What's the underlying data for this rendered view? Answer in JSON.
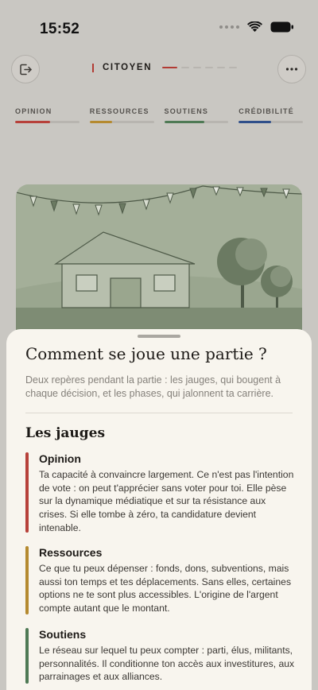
{
  "status": {
    "time": "15:52"
  },
  "header": {
    "role_label": "CITOYEN",
    "progress": {
      "total_steps": 6,
      "current_step": 1
    }
  },
  "gauges": [
    {
      "label": "OPINION",
      "value": 0.55,
      "color": "#b7413a"
    },
    {
      "label": "RESSOURCES",
      "value": 0.35,
      "color": "#b58a2f"
    },
    {
      "label": "SOUTIENS",
      "value": 0.62,
      "color": "#4f7a55"
    },
    {
      "label": "CRÉDIBILITÉ",
      "value": 0.5,
      "color": "#2f4f8a"
    }
  ],
  "sheet": {
    "title": "Comment se joue une partie ?",
    "intro": "Deux repères pendant la partie : les jauges, qui bougent à chaque décision, et les phases, qui jalonnent ta carrière.",
    "section_title": "Les jauges",
    "items": [
      {
        "title": "Opinion",
        "description": "Ta capacité à convaincre largement. Ce n'est pas l'intention de vote : on peut t'apprécier sans voter pour toi. Elle pèse sur la dynamique médiatique et sur ta résistance aux crises. Si elle tombe à zéro, ta candidature devient intenable.",
        "color": "#b7413a"
      },
      {
        "title": "Ressources",
        "description": "Ce que tu peux dépenser : fonds, dons, subventions, mais aussi ton temps et tes déplacements. Sans elles, certaines options ne te sont plus accessibles. L'origine de l'argent compte autant que le montant.",
        "color": "#b58a2f"
      },
      {
        "title": "Soutiens",
        "description": "Le réseau sur lequel tu peux compter : parti, élus, militants, personnalités. Il conditionne ton accès aux investitures, aux parrainages et aux alliances.",
        "color": "#4f7a55"
      }
    ]
  }
}
